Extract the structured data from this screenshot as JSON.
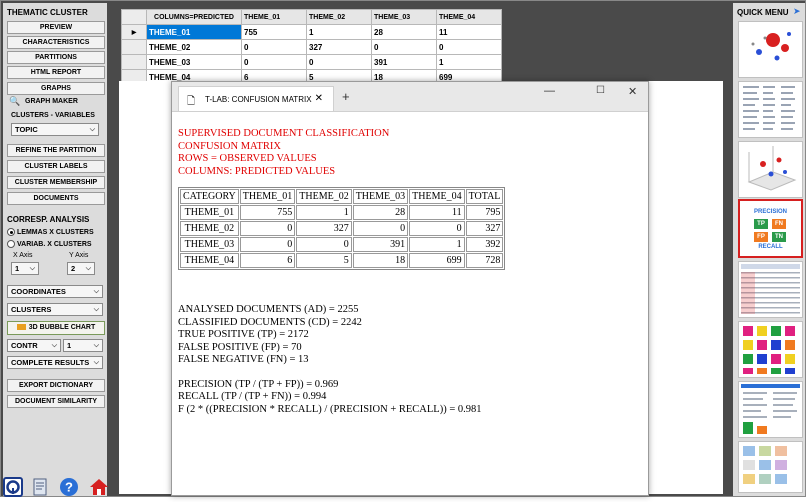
{
  "left_panel": {
    "title": "THEMATIC CLUSTER",
    "buttons": [
      "PREVIEW",
      "CHARACTERISTICS",
      "PARTITIONS",
      "HTML REPORT",
      "GRAPHS",
      "GRAPH MAKER"
    ],
    "clusters_variables_label": "CLUSTERS - VARIABLES",
    "topic_select": "TOPIC",
    "buttons2": [
      "REFINE THE PARTITION",
      "CLUSTER LABELS",
      "CLUSTER MEMBERSHIP",
      "DOCUMENTS"
    ],
    "corresp_title": "CORRESP. ANALYSIS",
    "radio_lemmas": "LEMMAS X CLUSTERS",
    "radio_variab": "VARIAB. X CLUSTERS",
    "x_axis_label": "X Axis",
    "y_axis_label": "Y Axis",
    "x_axis_value": "1",
    "y_axis_value": "2",
    "coordinates": "COORDINATES",
    "clusters": "CLUSTERS",
    "bubble_chart": "3D BUBBLE CHART",
    "contr": "CONTR",
    "contr_value": "1",
    "complete_results": "COMPLETE RESULTS",
    "export_dictionary": "EXPORT DICTIONARY",
    "document_similarity": "DOCUMENT SIMILARITY"
  },
  "grid": {
    "headers": [
      "COLUMNS=PREDICTED",
      "THEME_01",
      "THEME_02",
      "THEME_03",
      "THEME_04"
    ],
    "rows": [
      [
        "THEME_01",
        "755",
        "1",
        "28",
        "11"
      ],
      [
        "THEME_02",
        "0",
        "327",
        "0",
        "0"
      ],
      [
        "THEME_03",
        "0",
        "0",
        "391",
        "1"
      ],
      [
        "THEME_04",
        "6",
        "5",
        "18",
        "699"
      ]
    ]
  },
  "window": {
    "tab_title": "T-LAB: CONFUSION MATRIX",
    "heading_lines": [
      "SUPERVISED DOCUMENT CLASSIFICATION",
      "CONFUSION MATRIX",
      "ROWS = OBSERVED VALUES",
      "COLUMNS: PREDICTED VALUES"
    ],
    "table_headers": [
      "CATEGORY",
      "THEME_01",
      "THEME_02",
      "THEME_03",
      "THEME_04",
      "TOTAL"
    ],
    "table_rows": [
      [
        "THEME_01",
        "755",
        "1",
        "28",
        "11",
        "795"
      ],
      [
        "THEME_02",
        "0",
        "327",
        "0",
        "0",
        "327"
      ],
      [
        "THEME_03",
        "0",
        "0",
        "391",
        "1",
        "392"
      ],
      [
        "THEME_04",
        "6",
        "5",
        "18",
        "699",
        "728"
      ]
    ],
    "stats": [
      "ANALYSED DOCUMENTS (AD) = 2255",
      "CLASSIFIED DOCUMENTS (CD) = 2242",
      "TRUE POSITIVE (TP) = 2172",
      "FALSE POSITIVE (FP) = 70",
      "FALSE NEGATIVE (FN) = 13"
    ],
    "metrics": [
      "PRECISION (TP / (TP + FP)) = 0.969",
      "RECALL (TP / (TP + FN)) = 0.994",
      "F (2 * ((PRECISION * RECALL) / (PRECISION + RECALL)) = 0.981"
    ]
  },
  "right_panel": {
    "title": "QUICK MENU",
    "precision_label": "PRECISION",
    "recall_label": "RECALL",
    "tp": "TP",
    "fn": "FN",
    "fp": "FP",
    "tn": "TN"
  },
  "colors": {
    "selected": "#0078d7",
    "red_text": "#e00000",
    "highlight_border": "#d62020"
  }
}
